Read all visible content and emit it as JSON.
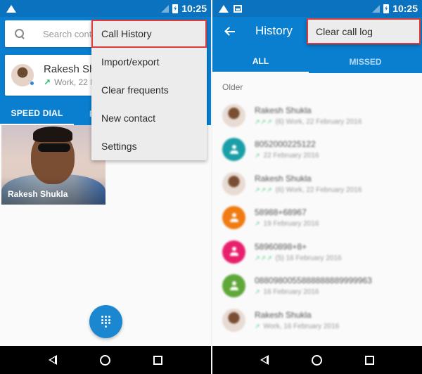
{
  "status_bar": {
    "time": "10:25"
  },
  "left_screen": {
    "search": {
      "placeholder": "Search conta"
    },
    "recent_contact": {
      "name": "Rakesh Shu",
      "detail": "Work, 22 F"
    },
    "tabs": [
      {
        "label": "SPEED DIAL",
        "active": true
      },
      {
        "label": "R",
        "active": false
      }
    ],
    "speed_dial": [
      {
        "name": "Rakesh Shukla"
      }
    ],
    "overflow_menu": {
      "items": [
        {
          "label": "Call History",
          "highlighted": true
        },
        {
          "label": "Import/export",
          "highlighted": false
        },
        {
          "label": "Clear frequents",
          "highlighted": false
        },
        {
          "label": "New contact",
          "highlighted": false
        },
        {
          "label": "Settings",
          "highlighted": false
        }
      ]
    },
    "fab_icon": "dialpad-icon"
  },
  "right_screen": {
    "title": "History",
    "overflow_menu": {
      "items": [
        {
          "label": "Clear call log",
          "highlighted": true
        }
      ]
    },
    "tabs": [
      {
        "label": "ALL",
        "active": true
      },
      {
        "label": "MISSED",
        "active": false
      }
    ],
    "section_label": "Older",
    "calls": [
      {
        "name": "Rakesh Shukla",
        "arrows": "↗↗↗",
        "detail": "(6) Work, 22 February 2016",
        "avatar": "photo",
        "color": ""
      },
      {
        "name": "8052000225122",
        "arrows": "↗",
        "detail": "22 February 2016",
        "avatar": "letter",
        "color": "#1a9ea7"
      },
      {
        "name": "Rakesh Shukla",
        "arrows": "↗↗↗",
        "detail": "(6) Work, 22 February 2016",
        "avatar": "photo",
        "color": ""
      },
      {
        "name": "58988+68967",
        "arrows": "↗",
        "detail": "19 February 2016",
        "avatar": "letter",
        "color": "#f07b12"
      },
      {
        "name": "58960898+8+",
        "arrows": "↗↗↗",
        "detail": "(5) 16 February 2016",
        "avatar": "letter",
        "color": "#e8206c"
      },
      {
        "name": "0880980055888888889999963",
        "arrows": "↗",
        "detail": "16 February 2016",
        "avatar": "letter",
        "color": "#5fa738"
      },
      {
        "name": "Rakesh Shukla",
        "arrows": "↗",
        "detail": "Work, 16 February 2016",
        "avatar": "photo",
        "color": ""
      }
    ]
  },
  "colors": {
    "primary": "#0a7fd0",
    "status_bar": "#0a72bf",
    "highlight_outline": "#e03b3b",
    "outgoing_arrow": "#2fb86a"
  }
}
